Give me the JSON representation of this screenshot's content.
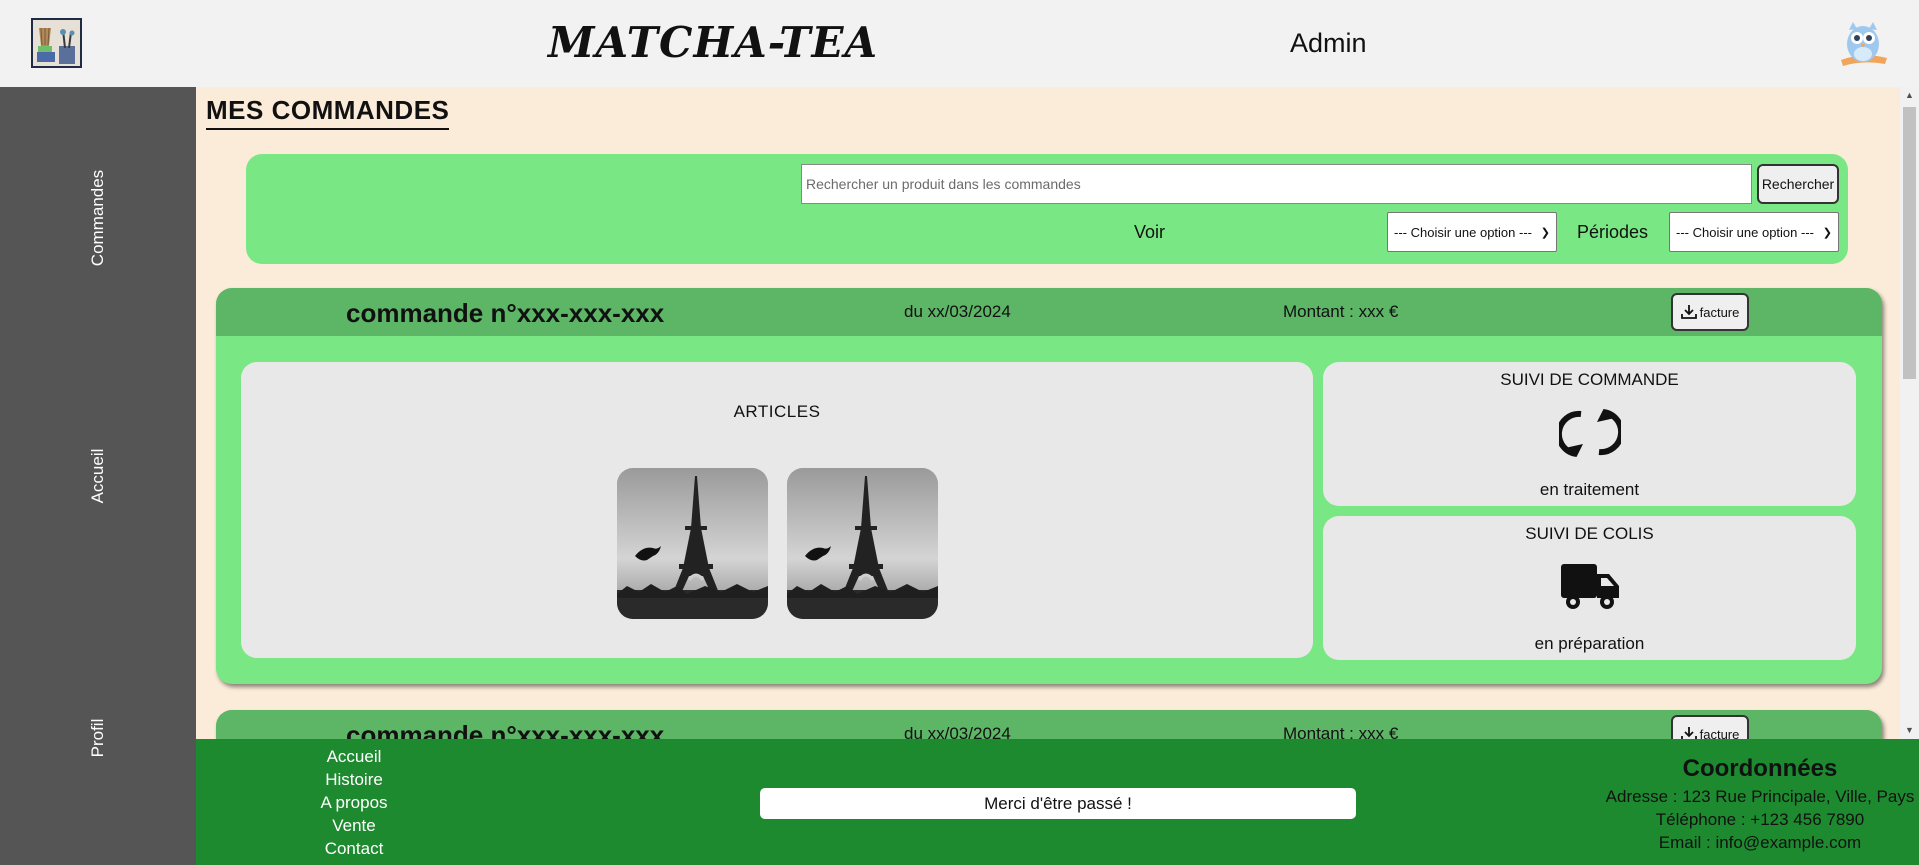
{
  "header": {
    "site_title": "MATCHA-TEA",
    "user_label": "Admin",
    "logo_icon": "matcha-tools-logo",
    "avatar_icon": "owl-icon"
  },
  "sidebar": {
    "items": [
      {
        "label": "Commandes"
      },
      {
        "label": "Accueil"
      },
      {
        "label": "Profil"
      }
    ]
  },
  "main": {
    "page_title": "MES COMMANDES",
    "search": {
      "placeholder": "Rechercher un produit dans les commandes",
      "button_label": "Rechercher"
    },
    "filters": {
      "voir_label": "Voir",
      "voir_value": "--- Choisir une option ---",
      "periodes_label": "Périodes",
      "periodes_value": "--- Choisir une option ---"
    },
    "orders": [
      {
        "number": "commande n°xxx-xxx-xxx",
        "date": "du xx/03/2024",
        "amount": "Montant : xxx €",
        "invoice_label": "facture",
        "articles_title": "ARTICLES",
        "order_tracking_title": "SUIVI DE COMMANDE",
        "order_tracking_status": "en traitement",
        "parcel_tracking_title": "SUIVI DE COLIS",
        "parcel_tracking_status": "en préparation"
      },
      {
        "number": "commande n°xxx-xxx-xxx",
        "date": "du xx/03/2024",
        "amount": "Montant : xxx €",
        "invoice_label": "facture"
      }
    ]
  },
  "footer": {
    "links": [
      {
        "label": "Accueil"
      },
      {
        "label": "Histoire"
      },
      {
        "label": "A propos"
      },
      {
        "label": "Vente"
      },
      {
        "label": "Contact"
      }
    ],
    "thanks": "Merci d'être passé !",
    "contact": {
      "title": "Coordonnées",
      "address": "Adresse : 123 Rue Principale, Ville, Pays",
      "phone": "Téléphone : +123 456 7890",
      "email": "Email : info@example.com"
    }
  },
  "colors": {
    "header_bg": "#f2f2f2",
    "sidebar_bg": "#555555",
    "main_bg": "#fbebd9",
    "panel_green": "#79e783",
    "order_header_green": "#5db566",
    "footer_green": "#1e8a30"
  }
}
